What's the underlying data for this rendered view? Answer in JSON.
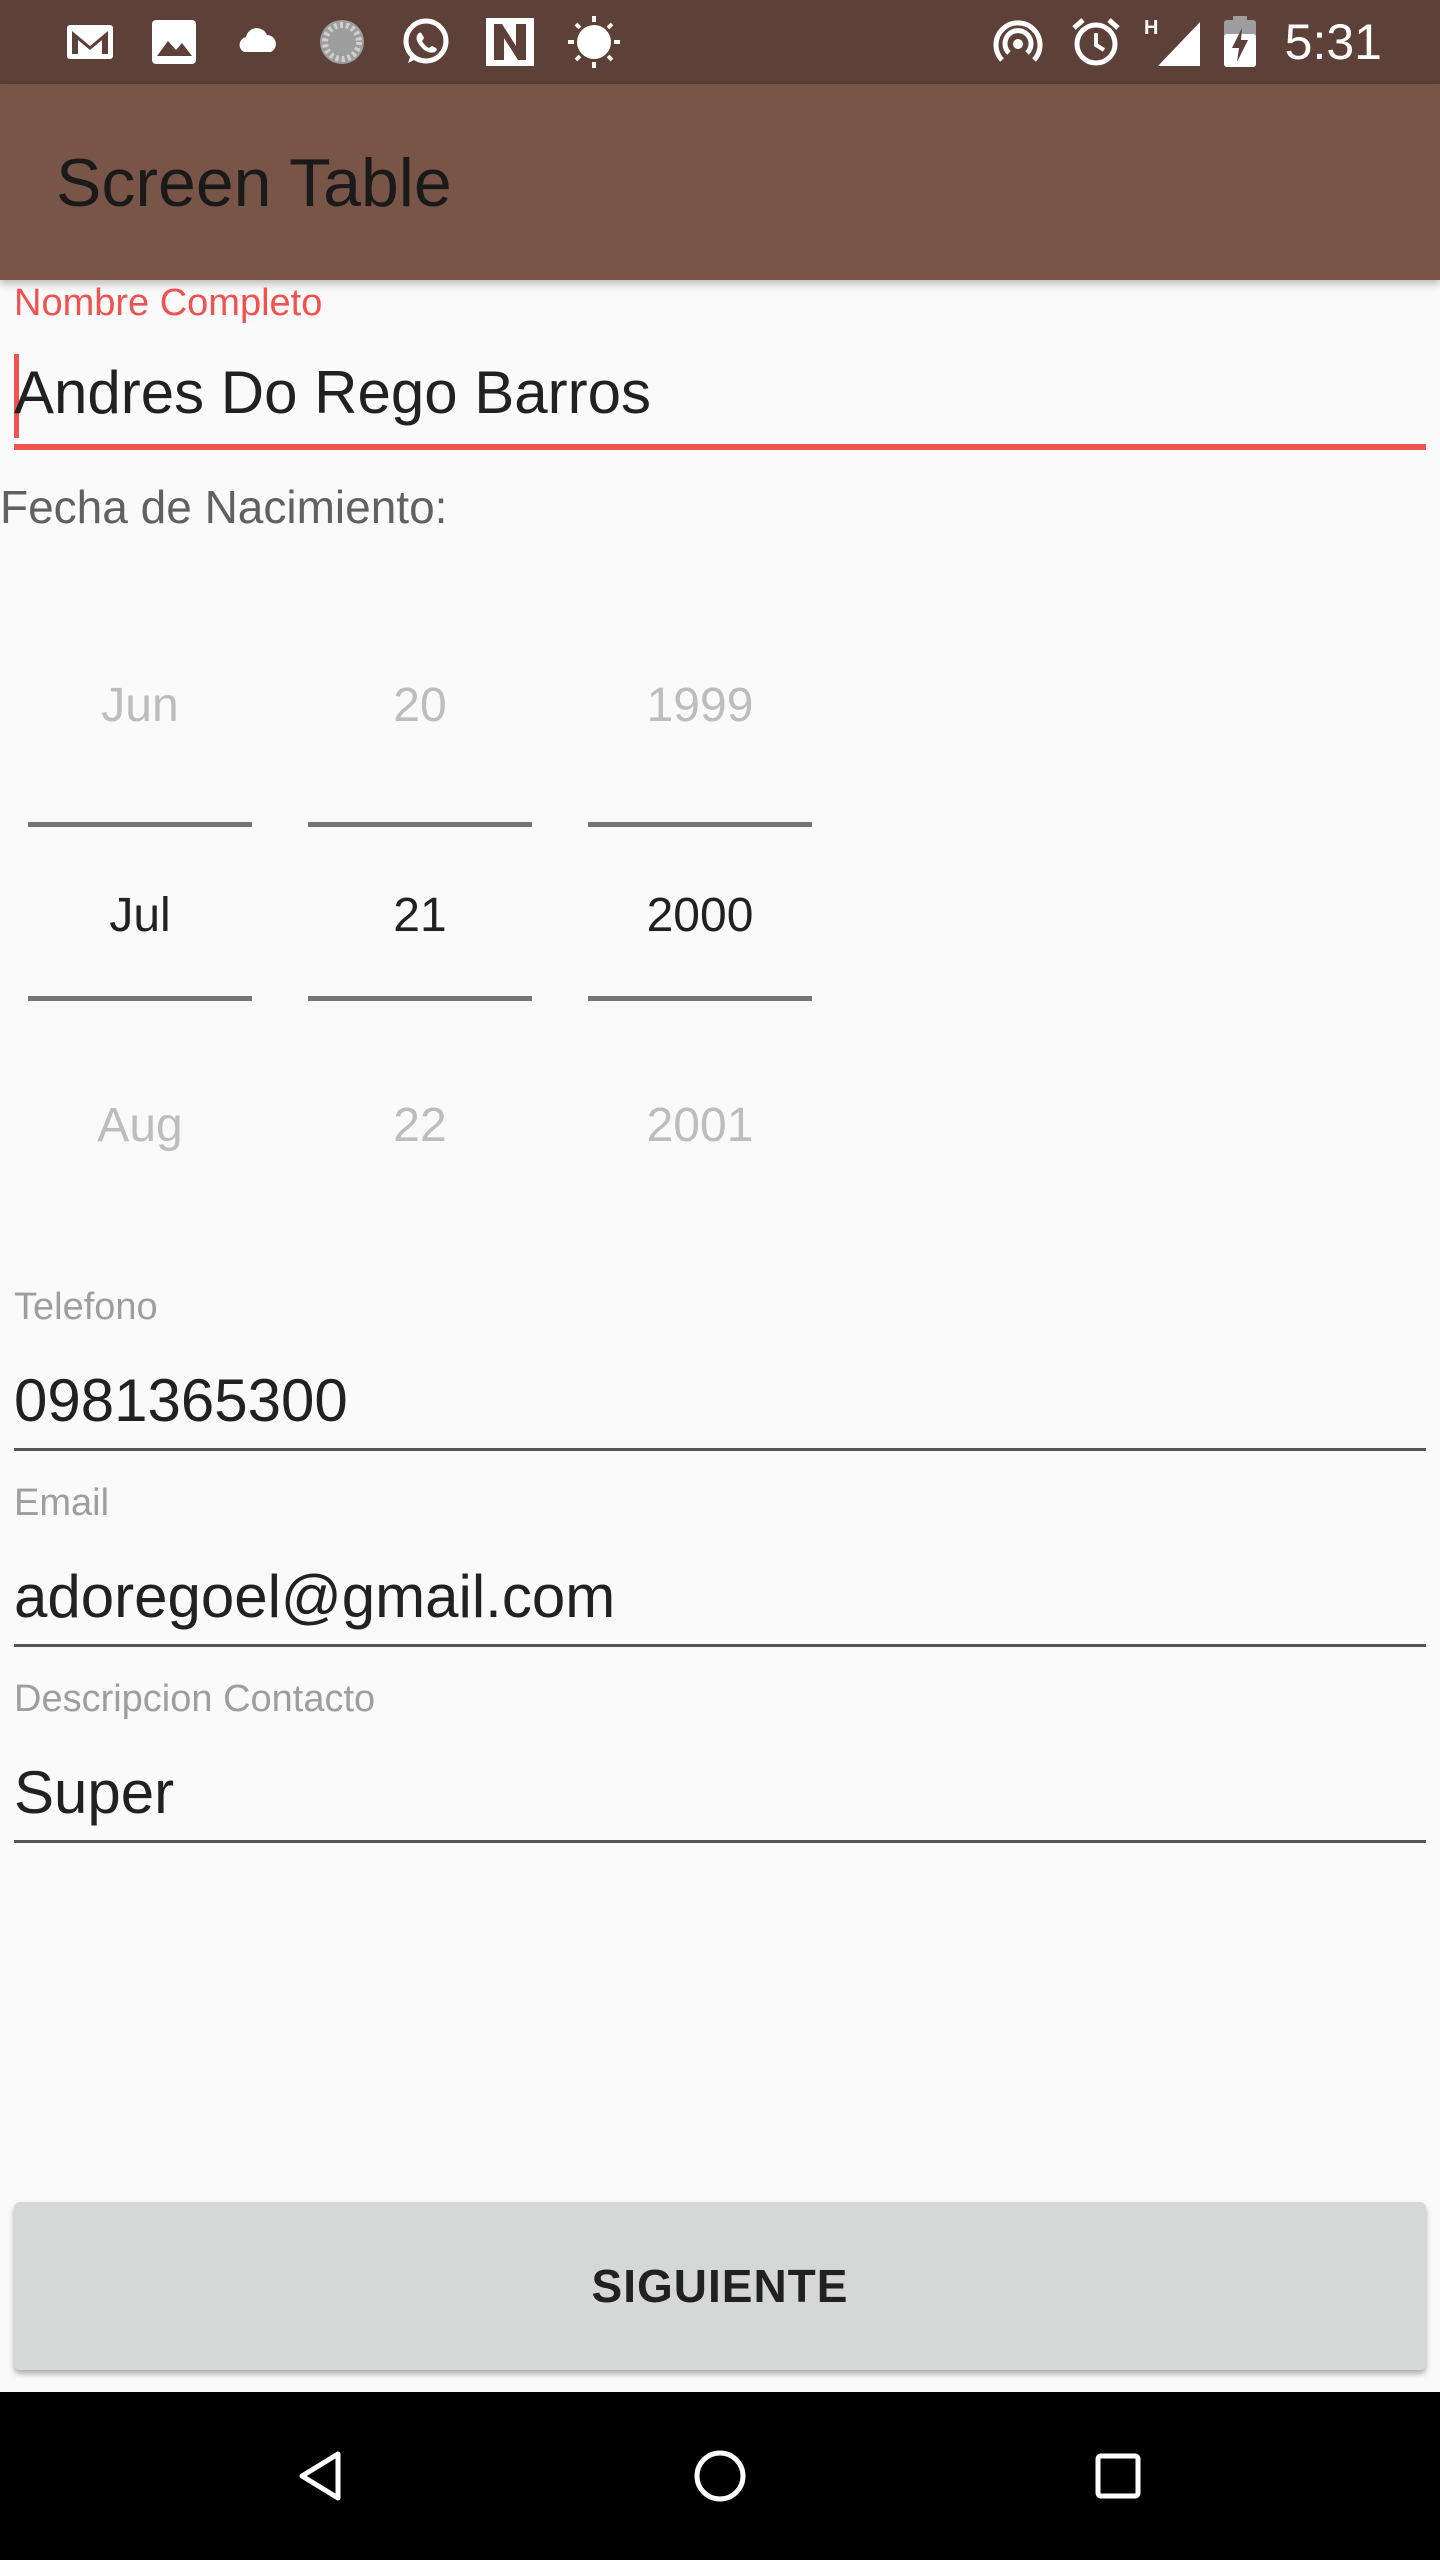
{
  "status_bar": {
    "time": "5:31",
    "network": "H",
    "icons": [
      "gmail-icon",
      "photo-icon",
      "cloud-icon",
      "sync-icon",
      "whatsapp-icon",
      "n-app-icon",
      "brightness-icon",
      "hotspot-icon",
      "alarm-icon",
      "signal-icon",
      "battery-charging-icon"
    ]
  },
  "app_bar": {
    "title": "Screen Table"
  },
  "form": {
    "name": {
      "label": "Nombre Completo",
      "value": "Andres Do Rego Barros"
    },
    "birthdate": {
      "label": "Fecha de Nacimiento:",
      "month": {
        "prev": "Jun",
        "current": "Jul",
        "next": "Aug"
      },
      "day": {
        "prev": "20",
        "current": "21",
        "next": "22"
      },
      "year": {
        "prev": "1999",
        "current": "2000",
        "next": "2001"
      }
    },
    "phone": {
      "label": "Telefono",
      "value": "0981365300"
    },
    "email": {
      "label": "Email",
      "value": "adoregoel@gmail.com"
    },
    "description": {
      "label": "Descripcion Contacto",
      "value": "Super"
    }
  },
  "actions": {
    "next_label": "SIGUIENTE"
  },
  "colors": {
    "status_bar": "#5d4037",
    "app_bar": "#795548",
    "accent": "#ef5350",
    "button": "#d6d7d7"
  },
  "nav_bar": {
    "icons": [
      "back-icon",
      "home-icon",
      "recents-icon"
    ]
  }
}
